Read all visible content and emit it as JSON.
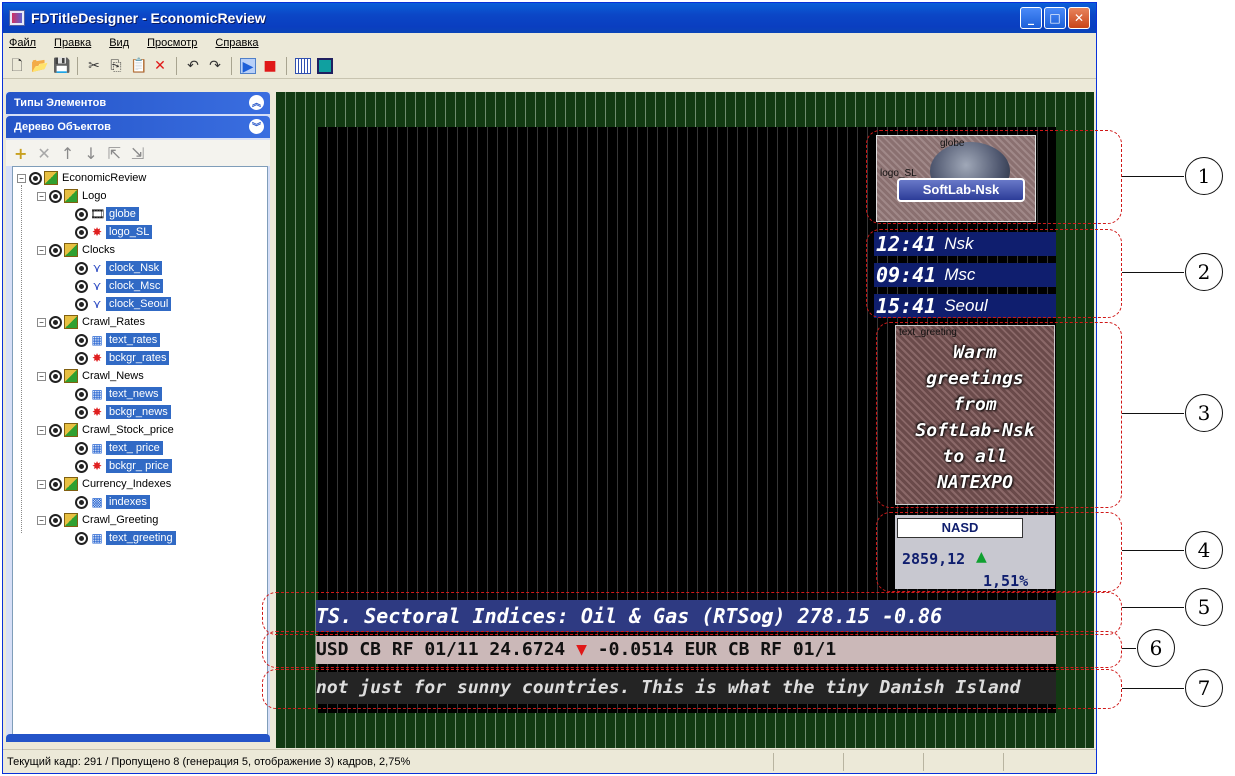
{
  "window": {
    "title": "FDTitleDesigner - EconomicReview"
  },
  "menu": [
    "Файл",
    "Правка",
    "Вид",
    "Просмотр",
    "Справка"
  ],
  "toolbar": {
    "icons": [
      "new-file-icon",
      "open-folder-icon",
      "save-icon",
      "cut-icon",
      "copy-icon",
      "paste-icon",
      "delete-icon",
      "undo-icon",
      "redo-icon",
      "play-icon",
      "stop-icon",
      "view-grid-icon",
      "view-frame-icon"
    ]
  },
  "panels": {
    "element_types": "Типы Элементов",
    "object_tree": "Дерево Объектов"
  },
  "tree": {
    "root": "EconomicReview",
    "groups": [
      {
        "label": "Logo",
        "children": [
          "globe",
          "logo_SL"
        ]
      },
      {
        "label": "Clocks",
        "children": [
          "clock_Nsk",
          "clock_Msc",
          "clock_Seoul"
        ]
      },
      {
        "label": "Crawl_Rates",
        "children": [
          "text_rates",
          "bckgr_rates"
        ]
      },
      {
        "label": "Crawl_News",
        "children": [
          "text_news",
          "bckgr_news"
        ]
      },
      {
        "label": "Crawl_Stock_price",
        "children": [
          "text_ price",
          "bckgr_ price"
        ]
      },
      {
        "label": "Currency_Indexes",
        "children": [
          "indexes"
        ]
      },
      {
        "label": "Crawl_Greeting",
        "children": [
          "text_greeting"
        ]
      }
    ]
  },
  "canvas": {
    "logo": {
      "globe_label": "globe",
      "logo_label": "logo_SL",
      "brand": "SoftLab-Nsk"
    },
    "clocks": [
      {
        "time": "12:41",
        "city": "Nsk"
      },
      {
        "time": "09:41",
        "city": "Msc"
      },
      {
        "time": "15:41",
        "city": "Seoul"
      }
    ],
    "greeting": {
      "label": "text_greeting",
      "lines": [
        "Warm",
        "greetings",
        "from",
        "SoftLab-Nsk",
        "to all",
        "NATEXPO"
      ]
    },
    "nasd": {
      "name": "NASD",
      "value": "2859,12",
      "change": "1,51%"
    },
    "crawl_rates": "TS. Sectoral Indices:    Oil & Gas (RTSog) 278.15   -0.86",
    "crawl_usd": {
      "part1": "USD CB RF 01/11  24.6724 ",
      "arrow": "▼",
      "part2": " -0.0514         EUR CB RF 01/1"
    },
    "crawl_news": "not just for sunny countries. This is what the tiny Danish Island"
  },
  "callouts": [
    "1",
    "2",
    "3",
    "4",
    "5",
    "6",
    "7"
  ],
  "status": {
    "text": "Текущий кадр: 291 / Пропущено 8 (генерация 5, отображение 3) кадров,  2,75%"
  },
  "colors": {
    "titlebar": "#0a46c6",
    "selection": "#316ac5",
    "canvas_bg": "#123a12",
    "clock_bg": "#0f1e6e",
    "callout": "#d01818"
  }
}
